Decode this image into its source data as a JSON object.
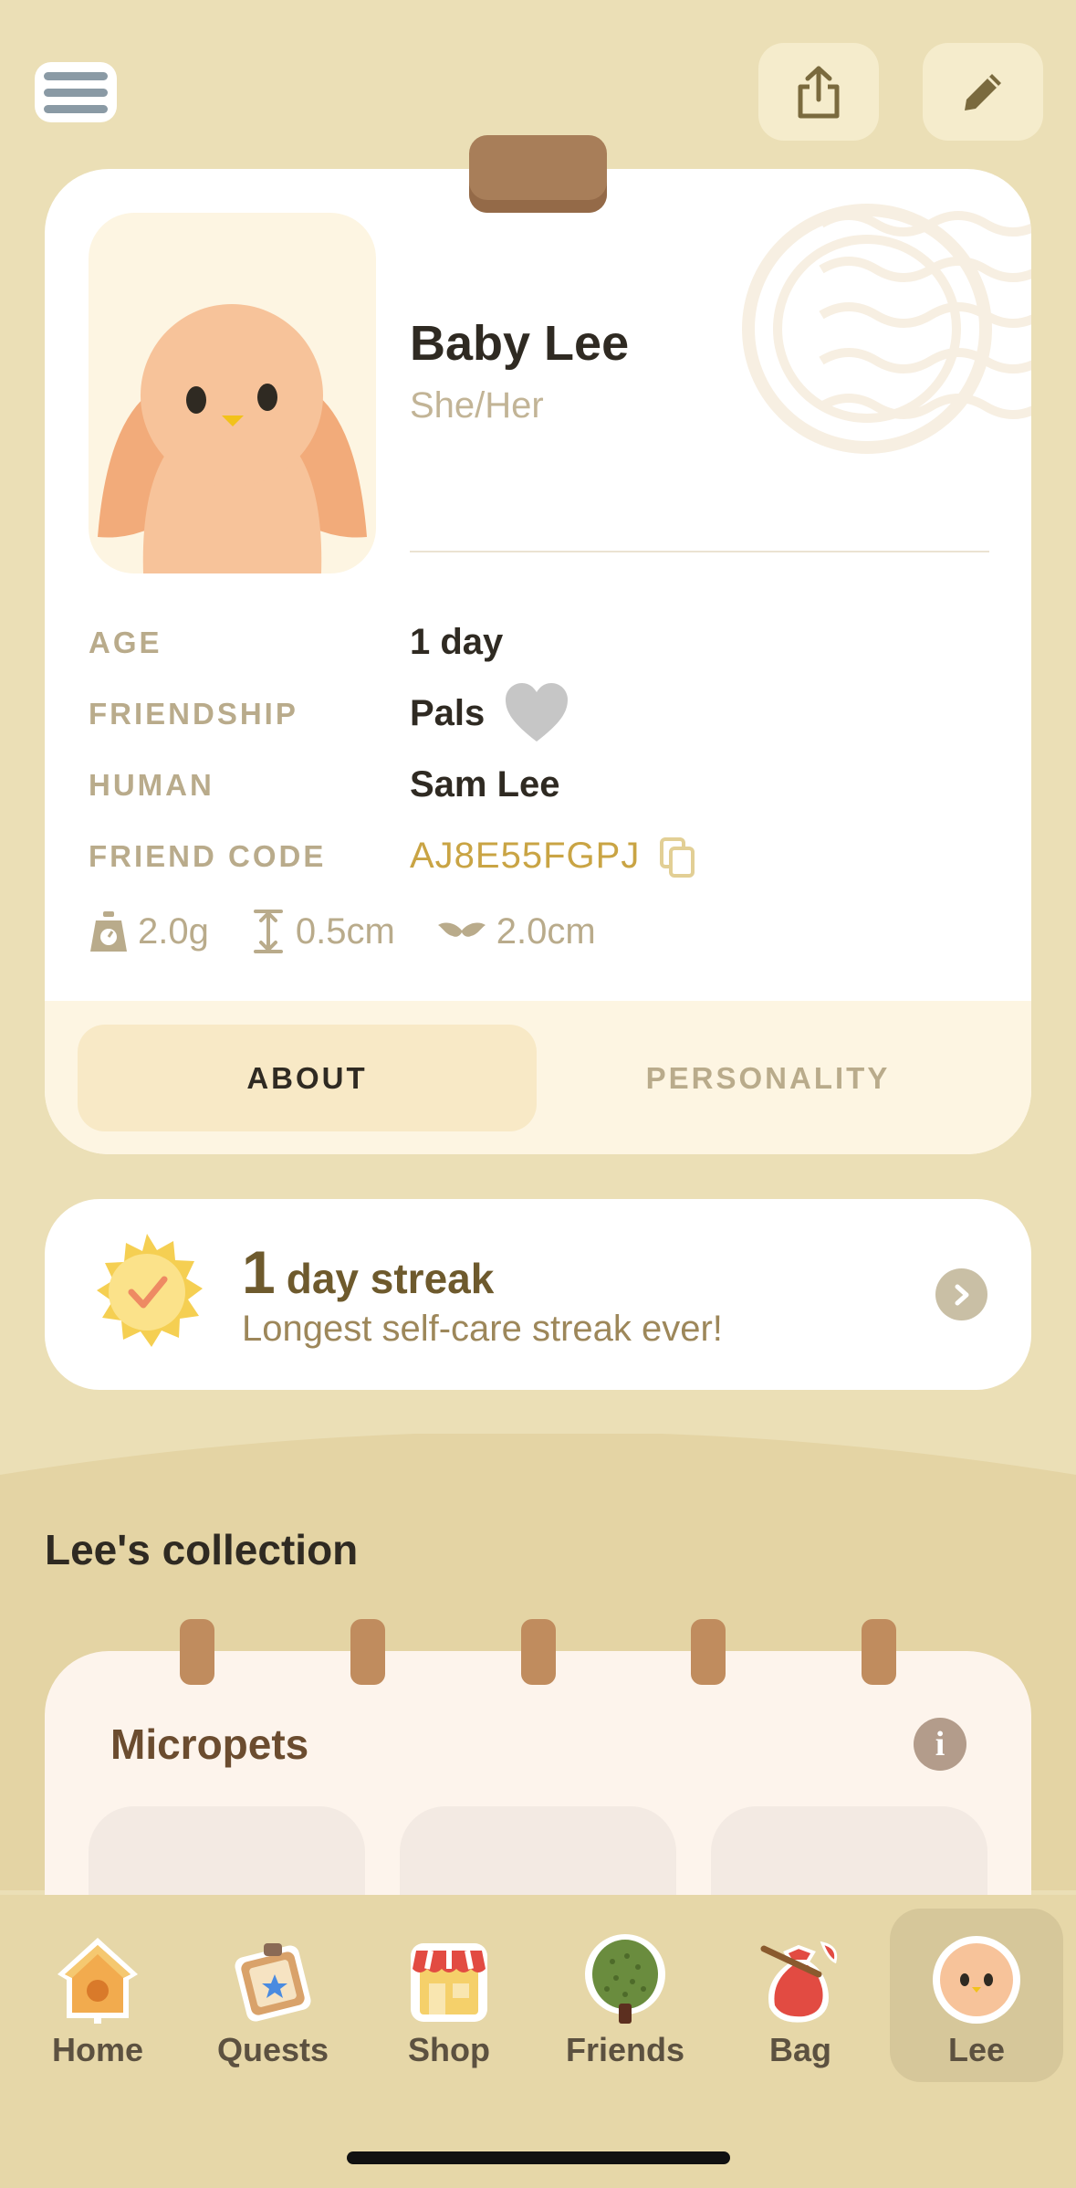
{
  "header": {
    "menu_icon": "hamburger-menu-icon",
    "share_icon": "share-icon",
    "edit_icon": "pencil-icon"
  },
  "profile": {
    "name": "Baby Lee",
    "pronouns": "She/Her",
    "fields": [
      {
        "label": "AGE",
        "value": "1 day"
      },
      {
        "label": "FRIENDSHIP",
        "value": "Pals"
      },
      {
        "label": "HUMAN",
        "value": "Sam Lee"
      },
      {
        "label": "FRIEND CODE",
        "value": "AJ8E55FGPJ"
      }
    ],
    "stats": {
      "weight": "2.0g",
      "height": "0.5cm",
      "wingspan": "2.0cm"
    },
    "tabs": [
      "ABOUT",
      "PERSONALITY"
    ],
    "active_tab": "ABOUT"
  },
  "streak": {
    "number": "1",
    "text": "day streak",
    "subtitle": "Longest self-care streak ever!"
  },
  "collection": {
    "title": "Lee's collection",
    "section_title": "Micropets"
  },
  "nav": {
    "items": [
      {
        "label": "Home",
        "icon": "birdhouse-icon"
      },
      {
        "label": "Quests",
        "icon": "quest-board-icon"
      },
      {
        "label": "Shop",
        "icon": "shop-icon"
      },
      {
        "label": "Friends",
        "icon": "tree-icon"
      },
      {
        "label": "Bag",
        "icon": "bag-icon"
      },
      {
        "label": "Lee",
        "icon": "bird-face-icon"
      }
    ],
    "active": "Lee"
  },
  "colors": {
    "background": "#EBDFB6",
    "accent_gold": "#C9A444",
    "streak_brown": "#6e5a2d",
    "tab_active": "#F8E9C6"
  }
}
